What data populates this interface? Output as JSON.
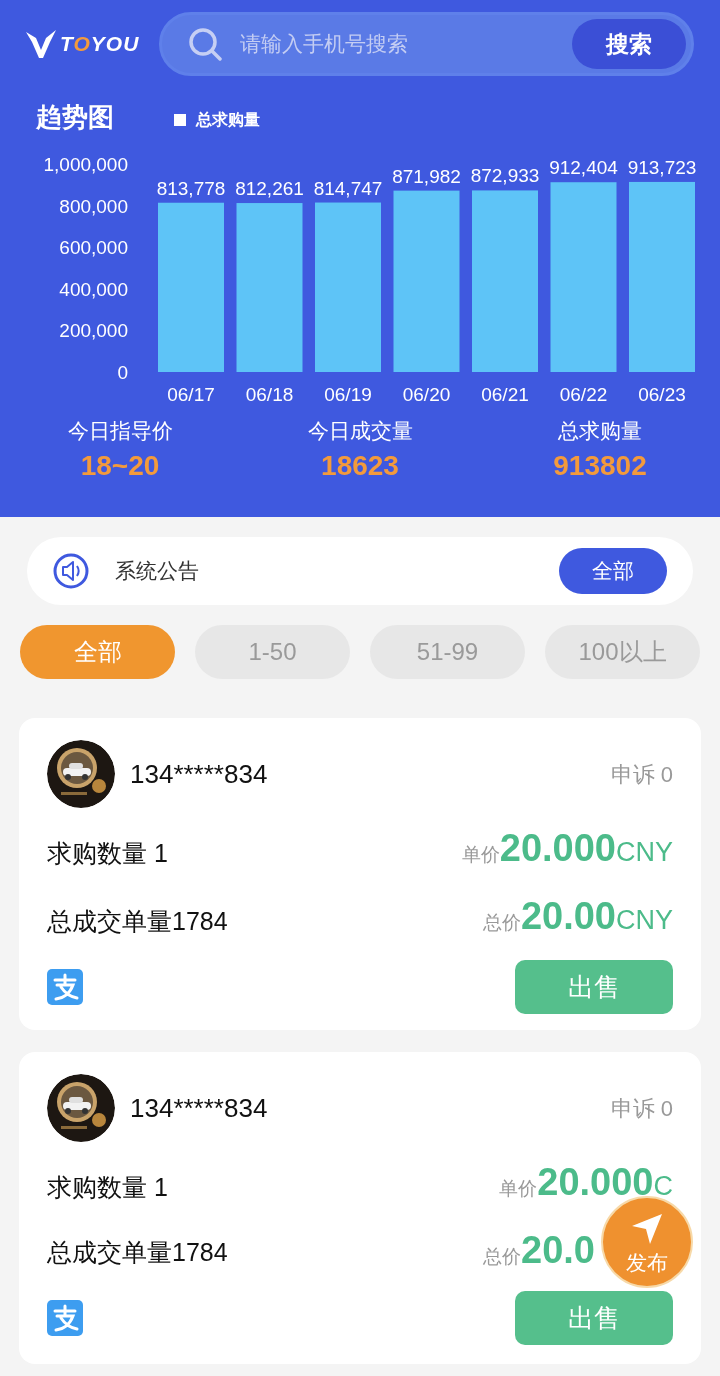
{
  "header": {
    "logo": [
      {
        "text": "T",
        "accent": false
      },
      {
        "text": "O",
        "accent": true
      },
      {
        "text": "YOU",
        "accent": false
      }
    ],
    "search": {
      "placeholder": "请输入手机号搜索",
      "button": "搜索"
    }
  },
  "trend": {
    "title": "趋势图",
    "chart_data": {
      "type": "bar",
      "categories": [
        "06/17",
        "06/18",
        "06/19",
        "06/20",
        "06/21",
        "06/22",
        "06/23"
      ],
      "series": [
        {
          "name": "总求购量",
          "color": "#5ec4f7",
          "values": [
            813778,
            812261,
            814747,
            871982,
            872933,
            912404,
            913723
          ]
        }
      ],
      "ylim": [
        0,
        1000000
      ],
      "yticks": [
        {
          "value": 0,
          "label": "0"
        },
        {
          "value": 200000,
          "label": "200,000"
        },
        {
          "value": 400000,
          "label": "400,000"
        },
        {
          "value": 600000,
          "label": "600,000"
        },
        {
          "value": 800000,
          "label": "800,000"
        },
        {
          "value": 1000000,
          "label": "1,000,000"
        }
      ],
      "value_labels": [
        "813,778",
        "812,261",
        "814,747",
        "871,982",
        "872,933",
        "912,404",
        "913,723"
      ]
    }
  },
  "stats": [
    {
      "label": "今日指导价",
      "value": "18~20"
    },
    {
      "label": "今日成交量",
      "value": "18623"
    },
    {
      "label": "总求购量",
      "value": "913802"
    }
  ],
  "notice": {
    "text": "系统公告",
    "button": "全部"
  },
  "filters": [
    {
      "label": "全部",
      "selected": true
    },
    {
      "label": "1-50",
      "selected": false
    },
    {
      "label": "51-99",
      "selected": false
    },
    {
      "label": "100以上",
      "selected": false
    }
  ],
  "orders": [
    {
      "phone": "134*****834",
      "complaint_label": "申诉",
      "complaint_count": "0",
      "quantity": "求购数量 1",
      "total_orders": "总成交单量1784",
      "unit_label": "单价",
      "unit_price": "20.000",
      "unit_currency": "CNY",
      "total_label": "总价",
      "total_price": "20.00",
      "total_currency": "CNY",
      "button": "出售"
    },
    {
      "phone": "134*****834",
      "complaint_label": "申诉",
      "complaint_count": "0",
      "quantity": "求购数量 1",
      "total_orders": "总成交单量1784",
      "unit_label": "单价",
      "unit_price": "20.000",
      "unit_currency": "C",
      "total_label": "总价",
      "total_price": "20.0",
      "button": "出售"
    }
  ],
  "fab": {
    "label": "发布"
  }
}
